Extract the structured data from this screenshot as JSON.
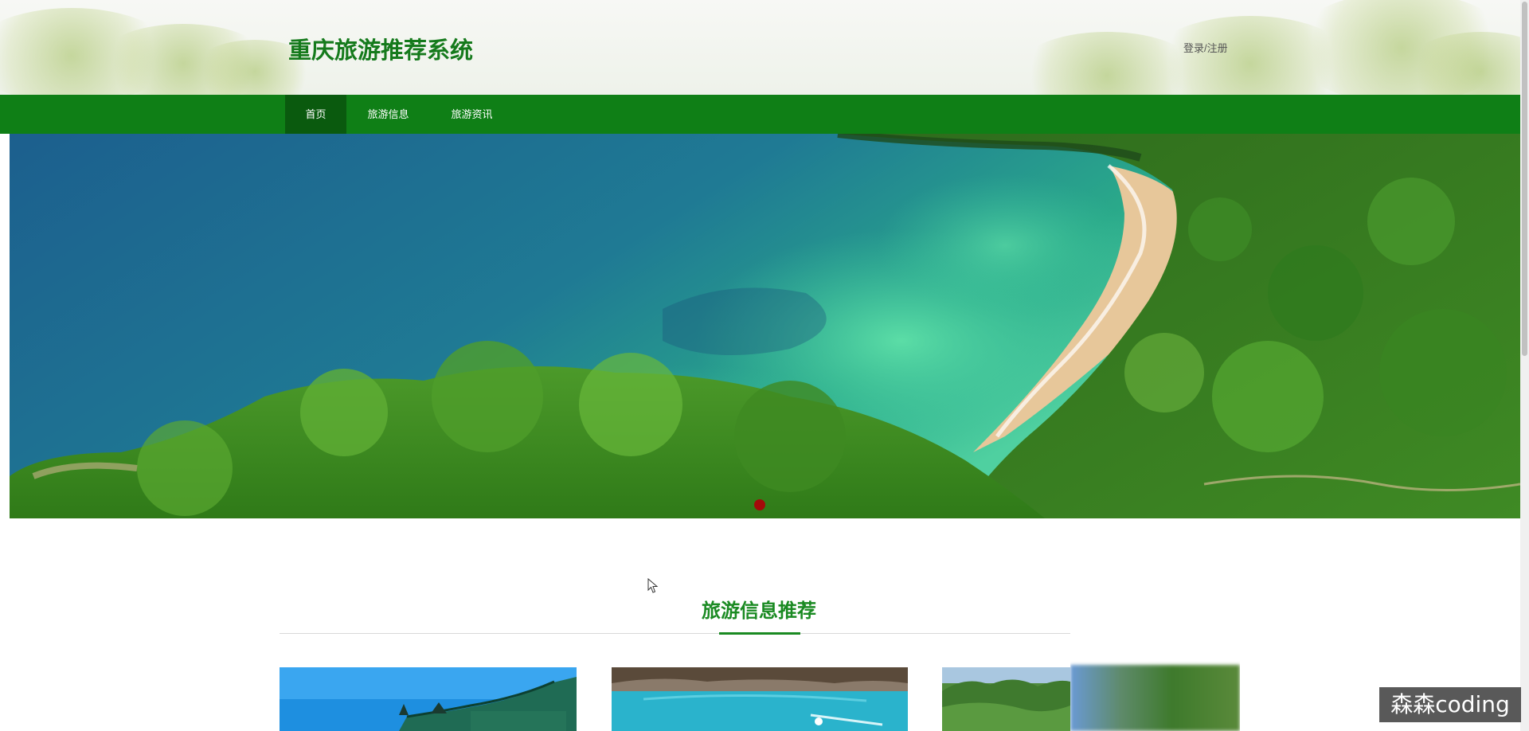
{
  "header": {
    "site_title": "重庆旅游推荐系统",
    "auth_link": "登录/注册"
  },
  "nav": {
    "items": [
      {
        "label": "首页",
        "active": true
      },
      {
        "label": "旅游信息",
        "active": false
      },
      {
        "label": "旅游资讯",
        "active": false
      }
    ]
  },
  "banner": {
    "slide_count": 1,
    "active_slide": 1
  },
  "section": {
    "title": "旅游信息推荐"
  },
  "cards": [
    {
      "image": "pagoda-roof-blue-sky"
    },
    {
      "image": "turquoise-pool"
    },
    {
      "image": "green-mountains"
    }
  ],
  "watermark": "森森coding",
  "colors": {
    "brand_green": "#0f7f16",
    "nav_active": "#0a5a0e",
    "title_green": "#157a1c",
    "section_green": "#1a8a22",
    "dot_red": "#a30a0a"
  }
}
